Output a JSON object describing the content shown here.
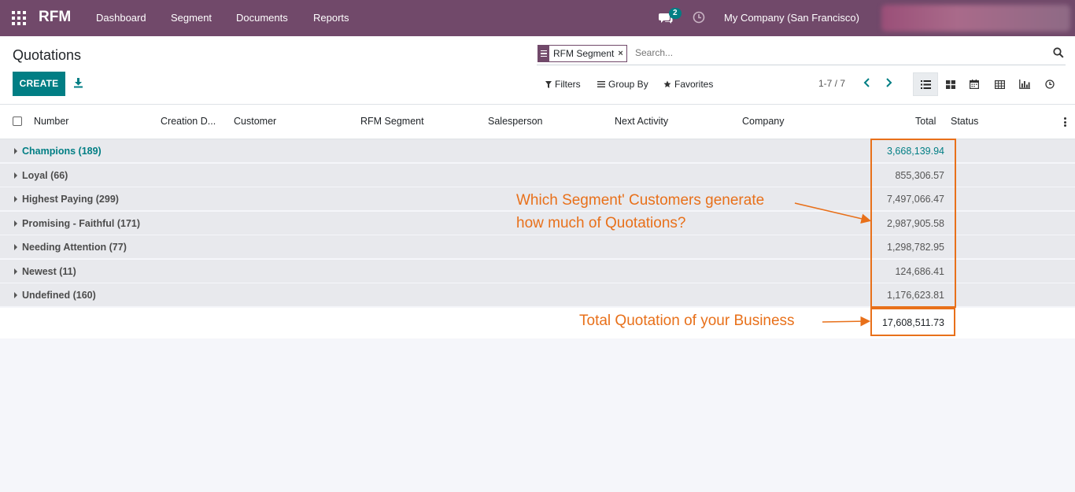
{
  "navbar": {
    "brand": "RFM",
    "menu": [
      "Dashboard",
      "Segment",
      "Documents",
      "Reports"
    ],
    "chat_count": "2",
    "company": "My Company (San Francisco)"
  },
  "control": {
    "title": "Quotations",
    "create_label": "CREATE",
    "facet_label": "RFM Segment",
    "facet_close": "×",
    "search_placeholder": "Search...",
    "filters_label": "Filters",
    "groupby_label": "Group By",
    "favorites_label": "Favorites",
    "pager": "1-7 / 7",
    "views": [
      "list-icon",
      "kanban-icon",
      "calendar-icon",
      "pivot-icon",
      "graph-icon",
      "activity-icon"
    ]
  },
  "table": {
    "columns": [
      "Number",
      "Creation D...",
      "Customer",
      "RFM Segment",
      "Salesperson",
      "Next Activity",
      "Company",
      "Total",
      "Status"
    ],
    "groups": [
      {
        "label": "Champions (189)",
        "total": "3,668,139.94"
      },
      {
        "label": "Loyal (66)",
        "total": "855,306.57"
      },
      {
        "label": "Highest Paying (299)",
        "total": "7,497,066.47"
      },
      {
        "label": "Promising - Faithful (171)",
        "total": "2,987,905.58"
      },
      {
        "label": "Needing Attention (77)",
        "total": "1,298,782.95"
      },
      {
        "label": "Newest (11)",
        "total": "124,686.41"
      },
      {
        "label": "Undefined (160)",
        "total": "1,176,623.81"
      }
    ],
    "grand_total": "17,608,511.73"
  },
  "annotations": {
    "segment_line1": "Which Segment' Customers generate",
    "segment_line2": "how much of Quotations?",
    "total_note": "Total Quotation of your Business"
  },
  "colors": {
    "navbar": "#71496a",
    "primary": "#017e84",
    "annotation": "#e8701a"
  }
}
